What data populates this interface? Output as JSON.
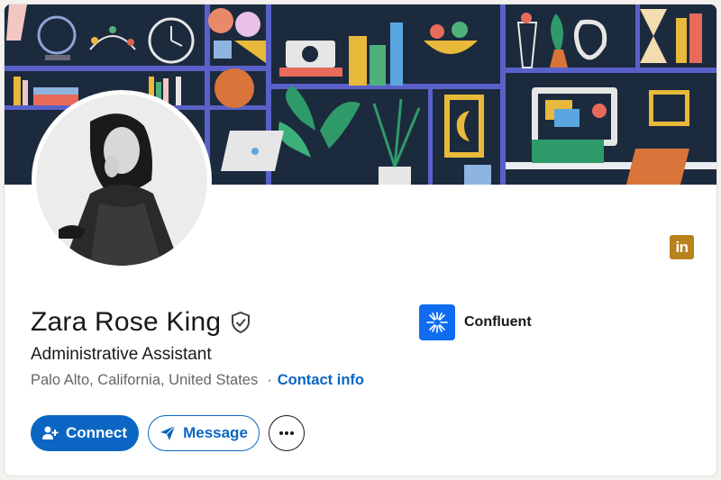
{
  "profile": {
    "name": "Zara Rose King",
    "headline": "Administrative Assistant",
    "location": "Palo Alto, California, United States",
    "separator": "·",
    "contact_info": "Contact info"
  },
  "company": {
    "name": "Confluent"
  },
  "actions": {
    "connect": "Connect",
    "message": "Message"
  },
  "badge": {
    "label": "in"
  },
  "icons": {
    "verify": "shield-check-icon",
    "connect": "add-person-icon",
    "message": "paper-plane-icon",
    "more": "ellipsis-icon"
  },
  "colors": {
    "brand_blue": "#0a66c2",
    "company_logo": "#0f6cf0",
    "linkedin_badge": "#b8821c",
    "banner_bg": "#1c2a3d"
  }
}
